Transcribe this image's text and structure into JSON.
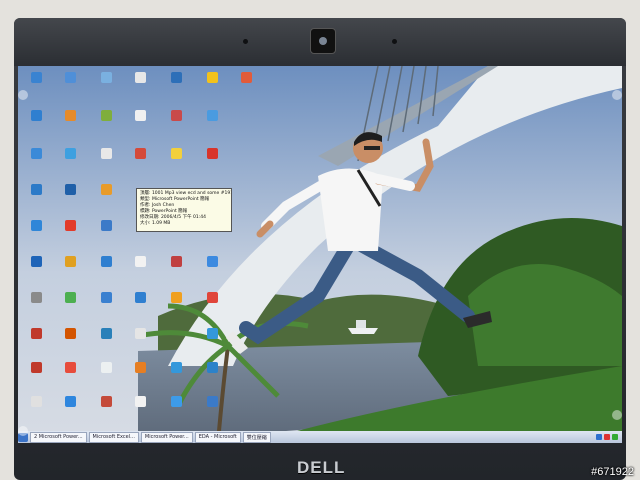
{
  "photo": {
    "subject": "man-leaping-in-front-of-bridge",
    "device_logo": "DELL",
    "watermark": "#671922"
  },
  "desktop": {
    "tooltip_lines": [
      "頂層: 1001 Mp3 view ecd and some #191#04.ppt",
      "類型: Microsoft PowerPoint 簡報",
      "作者: Josh Chen",
      "標題: PowerPoint 簡報",
      "修改日期: 2006/4/5 下午 01:44",
      "大小: 1.09 MB"
    ]
  },
  "taskbar": {
    "tasks": [
      "2 Microsoft Power...",
      "Microsoft Excel...",
      "Microsoft Power...",
      "EDA - Microsoft",
      "雙位壓縮"
    ]
  },
  "colors": {
    "sky": "#9fb4cf",
    "grass": "#3d7a2c",
    "bezel": "#2b2e33"
  }
}
